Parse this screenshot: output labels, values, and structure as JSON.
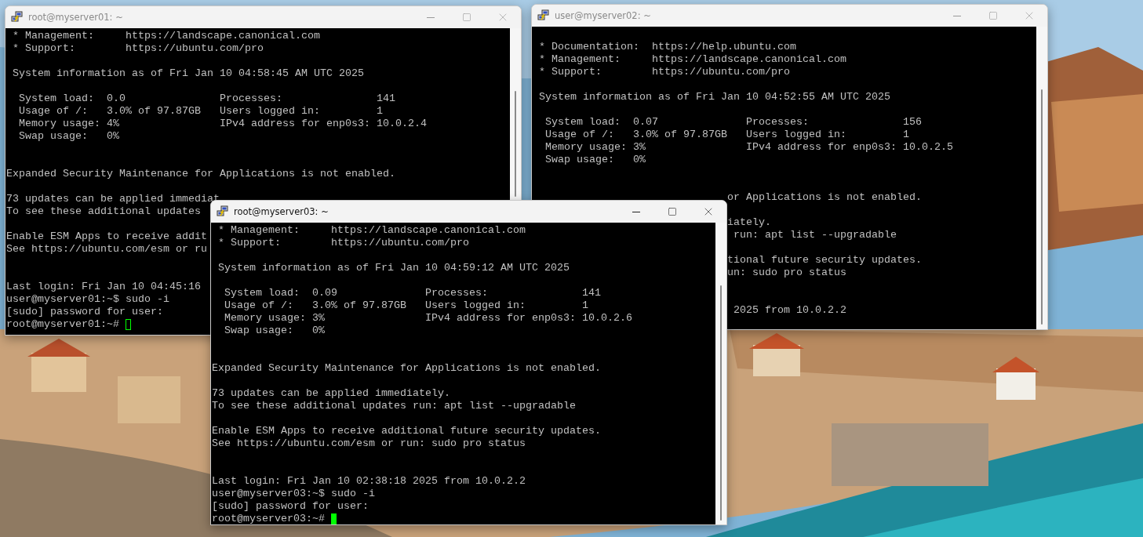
{
  "windows": [
    {
      "title": "root@myserver01: ~",
      "active": false,
      "lines": [
        {
          "kind": "text",
          "text": " * Management:     https://landscape.canonical.com"
        },
        {
          "kind": "text",
          "text": " * Support:        https://ubuntu.com/pro"
        },
        {
          "kind": "blank"
        },
        {
          "kind": "text",
          "text": " System information as of Fri Jan 10 04:58:45 AM UTC 2025"
        },
        {
          "kind": "blank"
        },
        {
          "kind": "text",
          "text": "  System load:  0.0               Processes:               141"
        },
        {
          "kind": "text",
          "text": "  Usage of /:   3.0% of 97.87GB   Users logged in:         1"
        },
        {
          "kind": "text",
          "text": "  Memory usage: 4%                IPv4 address for enp0s3: 10.0.2.4"
        },
        {
          "kind": "text",
          "text": "  Swap usage:   0%"
        },
        {
          "kind": "blank"
        },
        {
          "kind": "blank"
        },
        {
          "kind": "text",
          "text": "Expanded Security Maintenance for Applications is not enabled."
        },
        {
          "kind": "blank"
        },
        {
          "kind": "text",
          "text": "73 updates can be applied immediat"
        },
        {
          "kind": "text",
          "text": "To see these additional updates"
        },
        {
          "kind": "blank"
        },
        {
          "kind": "text",
          "text": "Enable ESM Apps to receive addit"
        },
        {
          "kind": "text",
          "text": "See https://ubuntu.com/esm or ru"
        },
        {
          "kind": "blank"
        },
        {
          "kind": "blank"
        },
        {
          "kind": "text",
          "text": "Last login: Fri Jan 10 04:45:16"
        },
        {
          "kind": "text",
          "text": "user@myserver01:~$ sudo -i"
        },
        {
          "kind": "text",
          "text": "[sudo] password for user:"
        },
        {
          "kind": "prompt",
          "text": "root@myserver01:~#"
        }
      ]
    },
    {
      "title": "user@myserver02: ~",
      "active": false,
      "lines": [
        {
          "kind": "blank"
        },
        {
          "kind": "text",
          "text": " * Documentation:  https://help.ubuntu.com"
        },
        {
          "kind": "text",
          "text": " * Management:     https://landscape.canonical.com"
        },
        {
          "kind": "text",
          "text": " * Support:        https://ubuntu.com/pro"
        },
        {
          "kind": "blank"
        },
        {
          "kind": "text",
          "text": " System information as of Fri Jan 10 04:52:55 AM UTC 2025"
        },
        {
          "kind": "blank"
        },
        {
          "kind": "text",
          "text": "  System load:  0.07              Processes:               156"
        },
        {
          "kind": "text",
          "text": "  Usage of /:   3.0% of 97.87GB   Users logged in:         1"
        },
        {
          "kind": "text",
          "text": "  Memory usage: 3%                IPv4 address for enp0s3: 10.0.2.5"
        },
        {
          "kind": "text",
          "text": "  Swap usage:   0%"
        },
        {
          "kind": "blank"
        },
        {
          "kind": "blank"
        },
        {
          "kind": "covered",
          "text": "or Applications is not enabled."
        },
        {
          "kind": "blank"
        },
        {
          "kind": "covered",
          "text": "iately."
        },
        {
          "kind": "covered",
          "text": " run: apt list --upgradable"
        },
        {
          "kind": "blank"
        },
        {
          "kind": "covered",
          "text": "tional future security updates."
        },
        {
          "kind": "covered",
          "text": "un: sudo pro status"
        },
        {
          "kind": "blank"
        },
        {
          "kind": "blank"
        },
        {
          "kind": "covered",
          "text": " 2025 from 10.0.2.2"
        }
      ]
    },
    {
      "title": "root@myserver03: ~",
      "active": true,
      "lines": [
        {
          "kind": "text",
          "text": " * Management:     https://landscape.canonical.com"
        },
        {
          "kind": "text",
          "text": " * Support:        https://ubuntu.com/pro"
        },
        {
          "kind": "blank"
        },
        {
          "kind": "text",
          "text": " System information as of Fri Jan 10 04:59:12 AM UTC 2025"
        },
        {
          "kind": "blank"
        },
        {
          "kind": "text",
          "text": "  System load:  0.09              Processes:               141"
        },
        {
          "kind": "text",
          "text": "  Usage of /:   3.0% of 97.87GB   Users logged in:         1"
        },
        {
          "kind": "text",
          "text": "  Memory usage: 3%                IPv4 address for enp0s3: 10.0.2.6"
        },
        {
          "kind": "text",
          "text": "  Swap usage:   0%"
        },
        {
          "kind": "blank"
        },
        {
          "kind": "blank"
        },
        {
          "kind": "text",
          "text": "Expanded Security Maintenance for Applications is not enabled."
        },
        {
          "kind": "blank"
        },
        {
          "kind": "text",
          "text": "73 updates can be applied immediately."
        },
        {
          "kind": "text",
          "text": "To see these additional updates run: apt list --upgradable"
        },
        {
          "kind": "blank"
        },
        {
          "kind": "text",
          "text": "Enable ESM Apps to receive additional future security updates."
        },
        {
          "kind": "text",
          "text": "See https://ubuntu.com/esm or run: sudo pro status"
        },
        {
          "kind": "blank"
        },
        {
          "kind": "blank"
        },
        {
          "kind": "text",
          "text": "Last login: Fri Jan 10 02:38:18 2025 from 10.0.2.2"
        },
        {
          "kind": "text",
          "text": "user@myserver03:~$ sudo -i"
        },
        {
          "kind": "text",
          "text": "[sudo] password for user:"
        },
        {
          "kind": "prompt",
          "text": "root@myserver03:~#"
        }
      ]
    }
  ]
}
